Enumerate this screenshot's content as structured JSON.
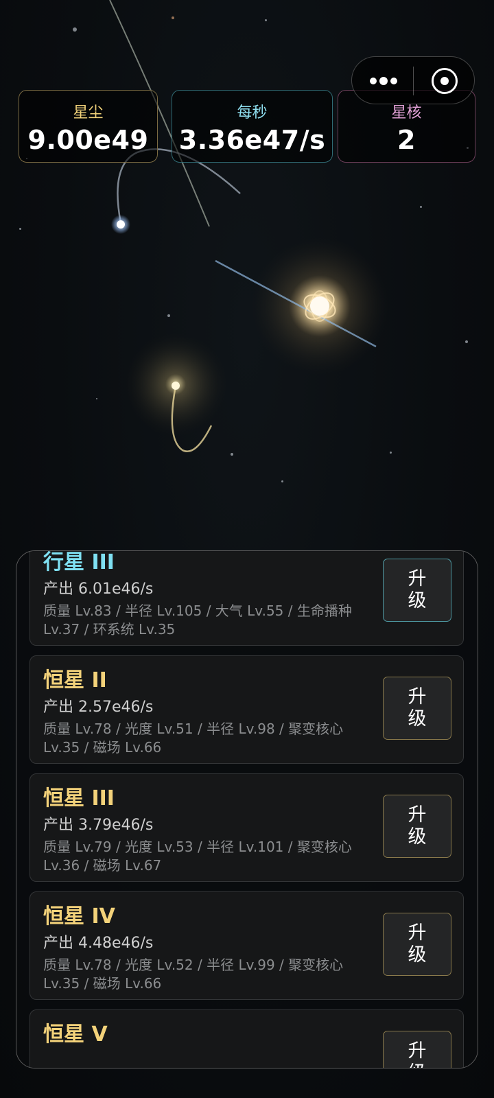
{
  "header": {
    "stardust": {
      "label": "星尘",
      "value": "9.00e49"
    },
    "per_second": {
      "label": "每秒",
      "value": "3.36e47/s"
    },
    "star_core": {
      "label": "星核",
      "value": "2"
    }
  },
  "capsule": {
    "more_icon": "more-dots-icon",
    "close_icon": "target-circle-icon"
  },
  "upgrades": [
    {
      "name": "行星 III",
      "output": "产出 6.01e46/s",
      "attributes": "质量 Lv.83 / 半径 Lv.105 / 大气 Lv.55 / 生命播种 Lv.37 / 环系统 Lv.35",
      "button": "升级"
    },
    {
      "name": "恒星 II",
      "output": "产出 2.57e46/s",
      "attributes": "质量 Lv.78 / 光度 Lv.51 / 半径 Lv.98 / 聚变核心 Lv.35 / 磁场 Lv.66",
      "button": "升级"
    },
    {
      "name": "恒星 III",
      "output": "产出 3.79e46/s",
      "attributes": "质量 Lv.79 / 光度 Lv.53 / 半径 Lv.101 / 聚变核心 Lv.36 / 磁场 Lv.67",
      "button": "升级"
    },
    {
      "name": "恒星 IV",
      "output": "产出 4.48e46/s",
      "attributes": "质量 Lv.78 / 光度 Lv.52 / 半径 Lv.99 / 聚变核心 Lv.35 / 磁场 Lv.66",
      "button": "升级"
    },
    {
      "name": "恒星 V",
      "output": "",
      "attributes": "",
      "button": "升级"
    }
  ],
  "colors": {
    "planet_accent": "#7fe0f2",
    "star_accent": "#f3d27a",
    "core_accent": "#e2a1d6"
  }
}
